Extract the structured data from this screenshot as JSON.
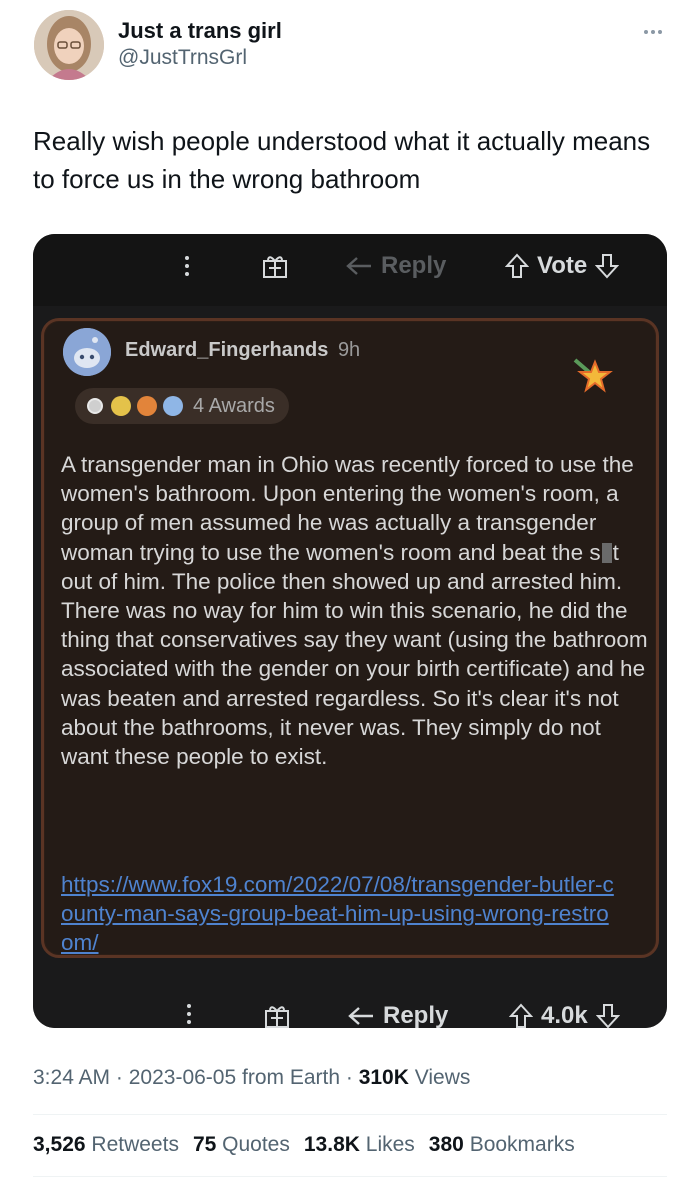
{
  "author": {
    "name": "Just a trans girl",
    "handle": "@JustTrnsGrl"
  },
  "tweet": {
    "text": "Really wish people understood what it actually means to force us in the wrong bathroom"
  },
  "media": {
    "top_actions": {
      "reply": "Reply",
      "vote": "Vote"
    },
    "comment": {
      "username": "Edward_Fingerhands",
      "time": "9h",
      "awards": "4 Awards",
      "body_before_censor": "A transgender man in Ohio was recently forced to use the women's bathroom. Upon entering the women's room, a group of men assumed he was actually a transgender woman trying to use the women's room and beat the s",
      "body_after_censor": "t out of him. The police then showed up and arrested him. There was no way for him to win this scenario, he did the thing that conservatives say they want (using the bathroom associated with the gender on your birth certificate) and he was beaten and arrested regardless. So it's clear it's not about the bathrooms, it never was. They simply do not want these people to exist.",
      "link": "https://www.fox19.com/2022/07/08/transgender-butler-county-man-says-group-beat-him-up-using-wrong-restroom/"
    },
    "bottom_actions": {
      "reply": "Reply",
      "votes": "4.0k"
    }
  },
  "meta": {
    "time": "3:24 AM",
    "date": "2023-06-05",
    "source": "from Earth",
    "views_count": "310K",
    "views_label": "Views"
  },
  "stats": {
    "retweets_count": "3,526",
    "retweets_label": "Retweets",
    "quotes_count": "75",
    "quotes_label": "Quotes",
    "likes_count": "13.8K",
    "likes_label": "Likes",
    "bookmarks_count": "380",
    "bookmarks_label": "Bookmarks"
  },
  "colors": {
    "text": "#0f1419",
    "secondary": "#536471",
    "link": "#4f83cf",
    "card_bg": "#241b16",
    "card_border": "#5a3424"
  }
}
